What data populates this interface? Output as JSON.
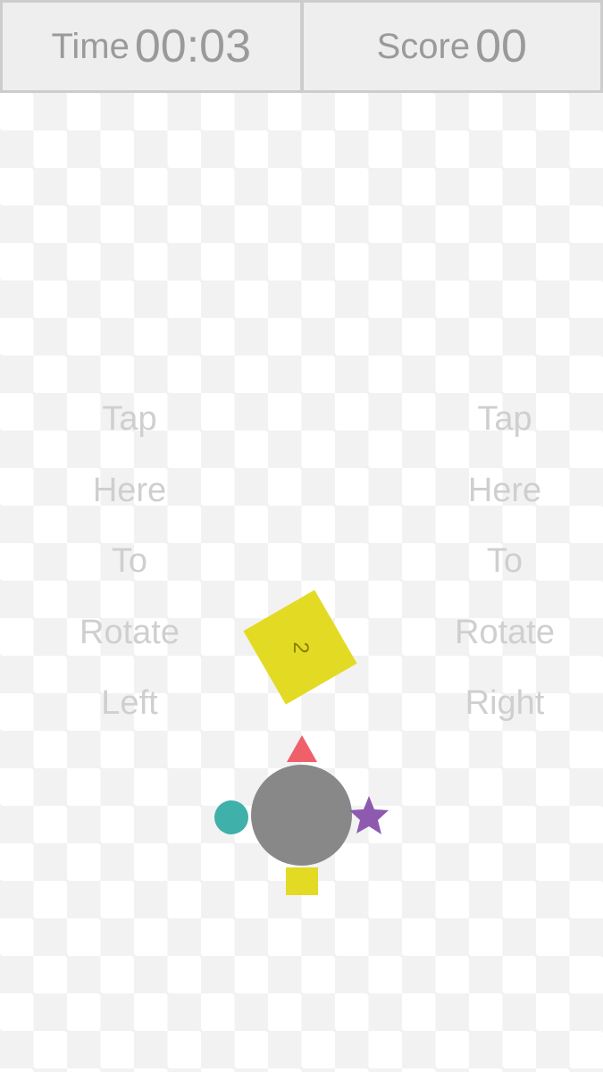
{
  "hud": {
    "time_label": "Time",
    "time_value": "00:03",
    "score_label": "Score",
    "score_value": "00"
  },
  "tap_left": {
    "words": [
      "Tap",
      "Here",
      "To",
      "Rotate",
      "Left"
    ]
  },
  "tap_right": {
    "words": [
      "Tap",
      "Here",
      "To",
      "Rotate",
      "Right"
    ]
  },
  "falling_block": {
    "number": "2",
    "color": "#e3da24"
  },
  "player": {
    "hub_color": "#888888",
    "shapes": [
      {
        "name": "triangle",
        "position": "top",
        "color": "#f0606a"
      },
      {
        "name": "star",
        "position": "right",
        "color": "#8e5ab0"
      },
      {
        "name": "square",
        "position": "bottom",
        "color": "#e3da24"
      },
      {
        "name": "circle",
        "position": "left",
        "color": "#3fb0aa"
      }
    ]
  }
}
